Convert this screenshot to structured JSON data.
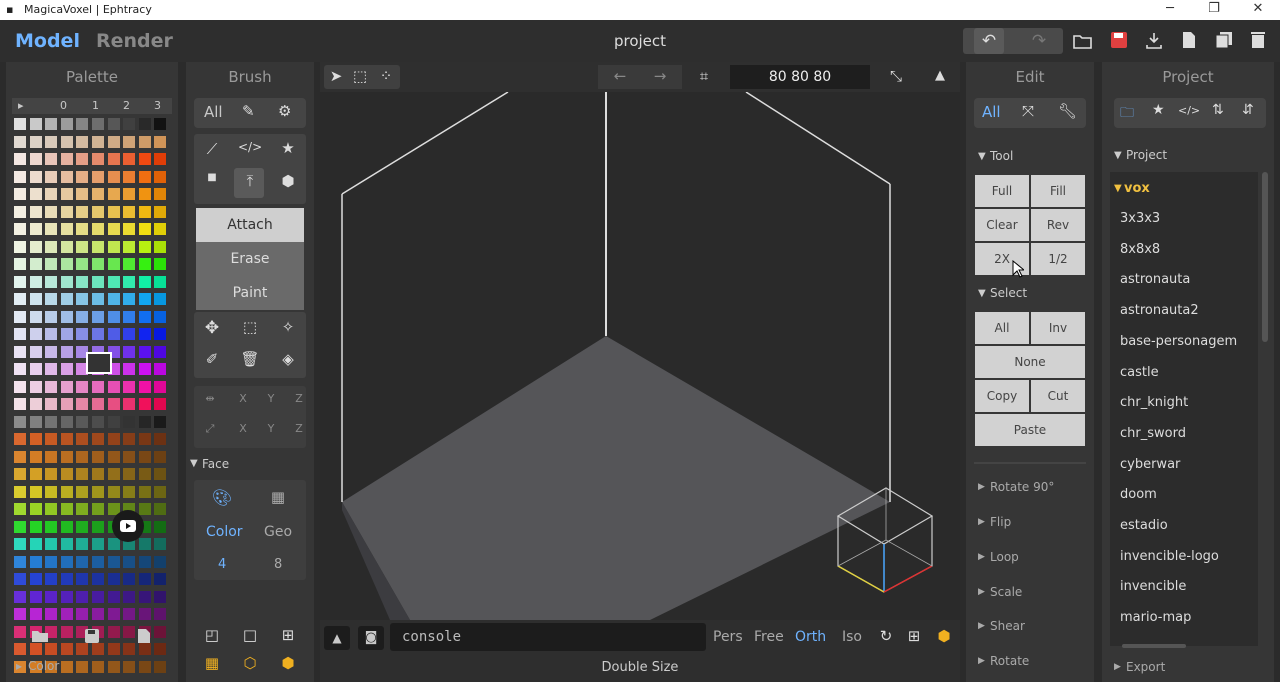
{
  "window": {
    "title": "MagicaVoxel | Ephtracy",
    "minimize": "─",
    "maximize": "❐",
    "close": "✕"
  },
  "header": {
    "model_tab": "Model",
    "render_tab": "Render",
    "project_title": "project"
  },
  "toolbar": {
    "undo": "↶",
    "redo": "↷",
    "icons": [
      "folder-open-icon",
      "save-icon",
      "download-icon",
      "file-icon",
      "copy-icon",
      "trash-icon"
    ]
  },
  "palette": {
    "title": "Palette",
    "tabs": [
      "▸",
      "0",
      "1",
      "2",
      "3"
    ],
    "footer_label": "Color"
  },
  "brush": {
    "title": "Brush",
    "all_label": "All",
    "modes": [
      "Attach",
      "Erase",
      "Paint"
    ],
    "axis_labels": [
      "X",
      "Y",
      "Z"
    ],
    "face_label": "Face",
    "color_label": "Color",
    "geo_label": "Geo",
    "color_count": "4",
    "geo_count": "8"
  },
  "viewport": {
    "nav_back": "←",
    "nav_fwd": "→",
    "size": "80 80 80",
    "console_placeholder": "console",
    "views": [
      "Pers",
      "Free",
      "Orth",
      "Iso"
    ],
    "active_view": "Orth",
    "status": "Double Size"
  },
  "edit": {
    "title": "Edit",
    "all_label": "All",
    "tool_section": "Tool",
    "tool_buttons": [
      "Full",
      "Fill",
      "Clear",
      "Rev",
      "2X",
      "1/2"
    ],
    "select_section": "Select",
    "select_buttons": [
      "All",
      "Inv",
      "None",
      "Copy",
      "Cut",
      "Paste"
    ],
    "actions": [
      "Rotate 90°",
      "Flip",
      "Loop",
      "Scale",
      "Shear",
      "Rotate"
    ]
  },
  "project": {
    "title": "Project",
    "section": "Project",
    "folder": "vox",
    "files": [
      "3x3x3",
      "8x8x8",
      "astronauta",
      "astronauta2",
      "base-personagem",
      "castle",
      "chr_knight",
      "chr_sword",
      "cyberwar",
      "doom",
      "estadio",
      "invencible-logo",
      "invencible",
      "mario-map"
    ],
    "export_label": "Export"
  },
  "colors": {
    "accent": "#6fb3ff",
    "folder_yellow": "#f0c040",
    "panel": "#363636",
    "viewport": "#2a2a2a"
  }
}
